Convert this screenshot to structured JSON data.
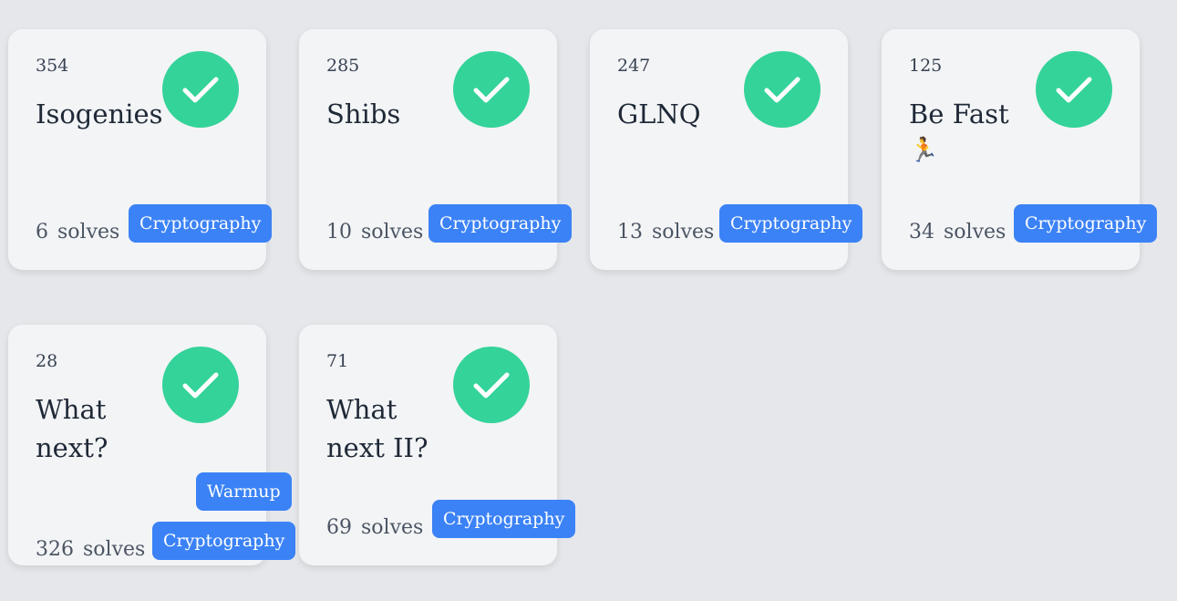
{
  "challenges": [
    {
      "points": "354",
      "title": "Isogenies",
      "solves_count": "6",
      "solves_label": "solves",
      "tags": [
        "Cryptography"
      ],
      "solved": true
    },
    {
      "points": "285",
      "title": "Shibs",
      "solves_count": "10",
      "solves_label": "solves",
      "tags": [
        "Cryptography"
      ],
      "solved": true
    },
    {
      "points": "247",
      "title": "GLNQ",
      "solves_count": "13",
      "solves_label": "solves",
      "tags": [
        "Cryptography"
      ],
      "solved": true
    },
    {
      "points": "125",
      "title": "Be Fast",
      "title_emoji": "🏃",
      "solves_count": "34",
      "solves_label": "solves",
      "tags": [
        "Cryptography"
      ],
      "solved": true
    },
    {
      "points": "28",
      "title_line1": "What",
      "title_line2": "next?",
      "solves_count": "326",
      "solves_label": "solves",
      "tags": [
        "Warmup",
        "Cryptography"
      ],
      "solved": true
    },
    {
      "points": "71",
      "title_line1": "What",
      "title_line2": "next II?",
      "solves_count": "69",
      "solves_label": "solves",
      "tags": [
        "Cryptography"
      ],
      "solved": true
    }
  ],
  "icons": {
    "solved": "checkmark-icon"
  },
  "colors": {
    "background": "#e5e7eb",
    "card": "#f3f4f6",
    "solved_badge": "#34d399",
    "tag": "#3b82f6"
  }
}
